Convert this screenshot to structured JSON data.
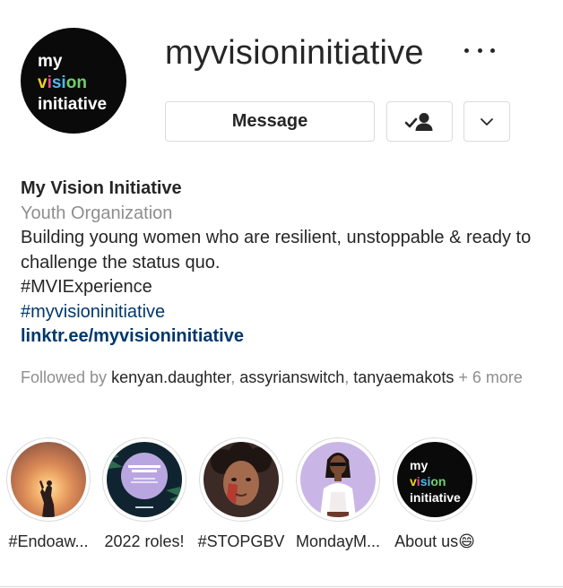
{
  "profile": {
    "avatar_logo": {
      "line1": "my",
      "line2_parts": [
        "v",
        "i",
        "si",
        "on"
      ],
      "line3": "initiative"
    },
    "username": "myvisioninitiative",
    "buttons": {
      "message": "Message"
    }
  },
  "bio": {
    "name": "My Vision Initiative",
    "category": "Youth Organization",
    "description": "Building young women who are resilient, unstoppable & ready to challenge the status quo.",
    "hashtag": "#MVIExperience",
    "hashtag_link": "#myvisioninitiative",
    "website": "linktr.ee/myvisioninitiative"
  },
  "followed_by": {
    "prefix": "Followed by",
    "users": [
      "kenyan.daughter",
      "assyrianswitch",
      "tanyaemakots"
    ],
    "separator": ", ",
    "suffix": "+ 6 more"
  },
  "highlights": [
    {
      "label": "#Endoaw..."
    },
    {
      "label": "2022 roles!"
    },
    {
      "label": "#STOPGBV"
    },
    {
      "label": "MondayM..."
    },
    {
      "label": "About us😄"
    }
  ],
  "colors": {
    "link": "#00376b",
    "muted": "#8e8e8e",
    "text": "#262626",
    "border": "#dbdbdb"
  }
}
